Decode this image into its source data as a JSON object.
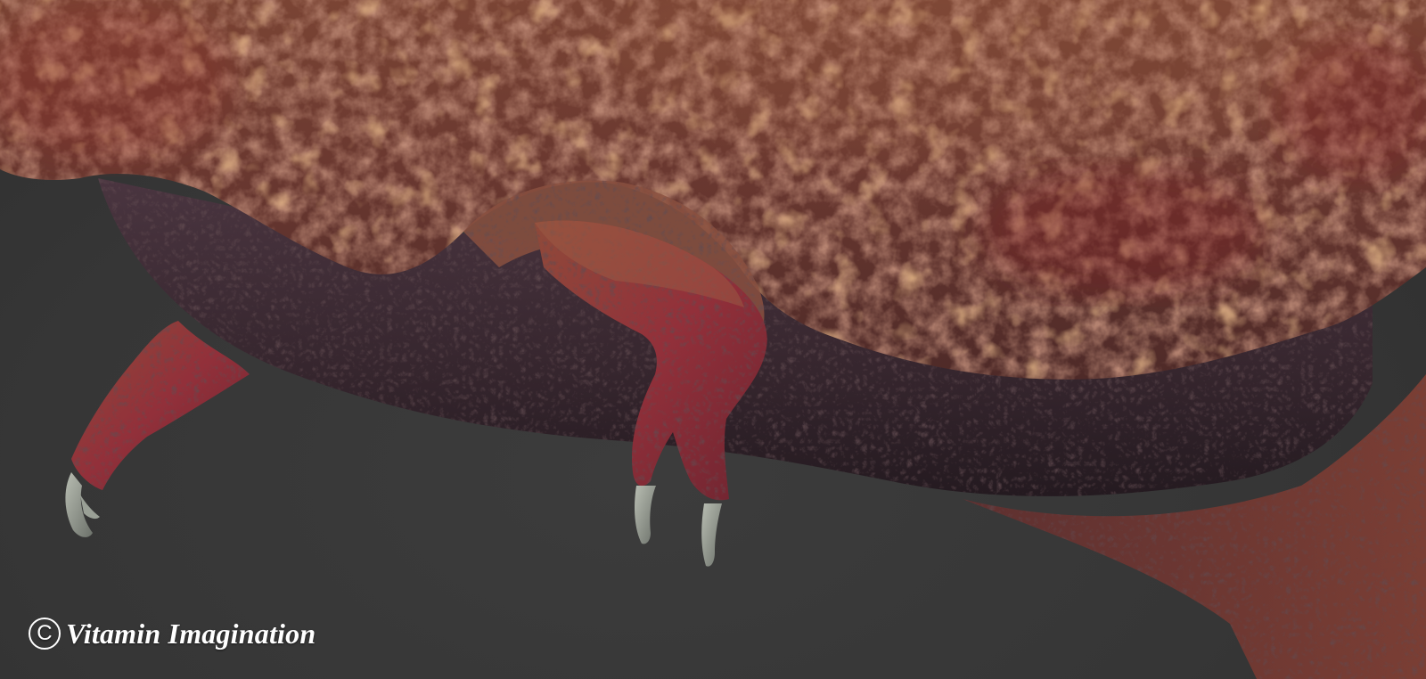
{
  "watermark": {
    "symbol": "C",
    "text": "Vitamin Imagination"
  },
  "palette": {
    "background": "#363636",
    "skin_top": "#6e3a2c",
    "skin_highlight": "#b0703e",
    "belly": "#3a2a33",
    "leg": "#8a2e35",
    "claw": "#8e948a"
  },
  "subject": "digital sculpture close-up of a creature's scaly body with two clawed legs"
}
